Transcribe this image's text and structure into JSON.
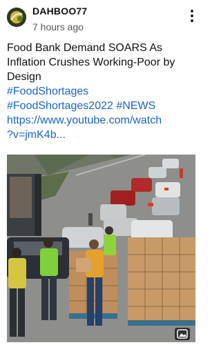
{
  "post": {
    "username": "DAHBOO77",
    "timestamp": "7 hours ago",
    "headline_lines": [
      "Food Bank Demand SOARS As",
      "Inflation Crushes Working-Poor by",
      "Design"
    ],
    "hashtag_line_1": "#FoodShortages",
    "hashtag_line_2": "#FoodShortages2022 #NEWS",
    "url_line_1": "https://www.youtube.com/watch",
    "url_line_2": "?v=jmK4b..."
  },
  "colors": {
    "link": "#1a63c9",
    "text": "#111111",
    "muted": "#555555"
  },
  "icons": {
    "more": "more-vertical-icon",
    "expand": "image-expand-icon"
  }
}
